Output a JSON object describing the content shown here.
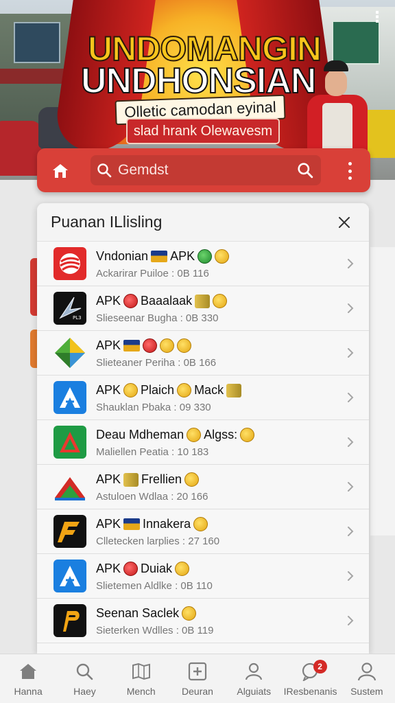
{
  "hero": {
    "title_line1": "UNDOMANGIN",
    "title_line2": "UNDHONSIAN",
    "tagline": "Olletic camodan eyinal",
    "banner": "slad hrank Olewavesm"
  },
  "appbar": {
    "search_value": "Gemdst",
    "home_icon": "home-icon",
    "search_icon": "search-icon",
    "more_icon": "more-vertical-icon",
    "accent": "#d94038"
  },
  "panel": {
    "title": "Puanan ILlisling",
    "close_icon": "close-icon"
  },
  "apps": [
    {
      "title_parts": [
        "Vndonian",
        "APK"
      ],
      "subtitle": "Ackarirar Puiloe : 0B 116",
      "icon": "red-stripes-app-icon",
      "emojis": [
        "flag",
        "green",
        "star"
      ]
    },
    {
      "title_parts": [
        "APK",
        "Baaalaak"
      ],
      "subtitle": "Slieseenar Bugha : 0B 330",
      "icon": "silver-star-app-icon",
      "emojis": [
        "red",
        "blk",
        "star"
      ]
    },
    {
      "title_parts": [
        "APK"
      ],
      "subtitle": "Slieteaner Periha : 0B 166",
      "icon": "green-diamond-app-icon",
      "emojis": [
        "flag",
        "red",
        "star",
        "star"
      ]
    },
    {
      "title_parts": [
        "APK",
        "Plaich",
        "Mack"
      ],
      "subtitle": "Shauklan Pbaka : 09 330",
      "icon": "blue-a-app-icon",
      "emojis": [
        "star",
        "star",
        "blk"
      ]
    },
    {
      "title_parts": [
        "Deau Mdheman",
        "Algss:"
      ],
      "subtitle": "Maliellen Peatia : 10 183",
      "icon": "green-a-app-icon",
      "emojis": [
        "star",
        "star"
      ]
    },
    {
      "title_parts": [
        "APK",
        "Frellien"
      ],
      "subtitle": "Astuloen Wdlaa : 20 166",
      "icon": "mountain-app-icon",
      "emojis": [
        "blk",
        "star"
      ]
    },
    {
      "title_parts": [
        "APK",
        "Innakera"
      ],
      "subtitle": "Clletecken larplies : 27 160",
      "icon": "orange-f-app-icon",
      "emojis": [
        "flag",
        "star"
      ]
    },
    {
      "title_parts": [
        "APK",
        "Duiak"
      ],
      "subtitle": "Slietemen Aldlke : 0B 110",
      "icon": "blue-a-app-icon",
      "emojis": [
        "red",
        "star"
      ]
    },
    {
      "title_parts": [
        "Seenan Saclek"
      ],
      "subtitle": "Sieterken Wdlles : 0B 119",
      "icon": "orange-p-app-icon",
      "emojis": [
        "star"
      ]
    }
  ],
  "bottom_nav": [
    {
      "label": "Hanna",
      "icon": "home-icon"
    },
    {
      "label": "Haey",
      "icon": "search-icon"
    },
    {
      "label": "Mench",
      "icon": "map-icon"
    },
    {
      "label": "Deuran",
      "icon": "add-box-icon"
    },
    {
      "label": "Alguiats",
      "icon": "user-icon"
    },
    {
      "label": "IResbenanis",
      "icon": "chat-icon",
      "badge": "2"
    },
    {
      "label": "Sustem",
      "icon": "profile-icon"
    }
  ]
}
